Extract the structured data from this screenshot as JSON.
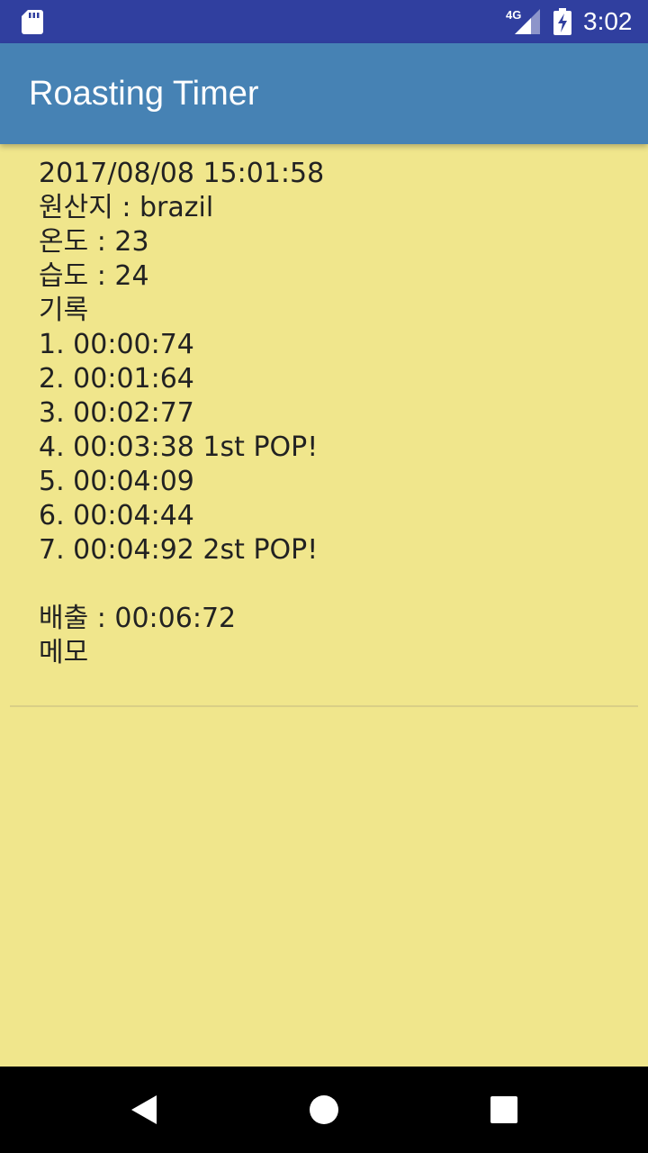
{
  "status_bar": {
    "time": "3:02",
    "network": "4G",
    "icons": [
      "sd-card-icon",
      "cellular-signal-icon",
      "battery-charging-icon"
    ]
  },
  "app_bar": {
    "title": "Roasting Timer"
  },
  "record": {
    "datetime": "2017/08/08 15:01:58",
    "origin": "원산지 : brazil",
    "temperature": "온도 : 23",
    "humidity": "습도 : 24",
    "log_label": "기록",
    "laps": [
      "1. 00:00:74",
      "2. 00:01:64",
      "3. 00:02:77",
      "4. 00:03:38 1st POP!",
      "5. 00:04:09",
      "6. 00:04:44",
      "7. 00:04:92 2st POP!"
    ],
    "discharge": "배출 : 00:06:72",
    "memo_label": "메모"
  },
  "nav_bar": {
    "icons": [
      "back-icon",
      "home-icon",
      "recent-apps-icon"
    ]
  },
  "colors": {
    "status_bar": "#303f9f",
    "app_bar": "#4682b4",
    "background": "#f0e68c",
    "nav_bar": "#000000"
  }
}
